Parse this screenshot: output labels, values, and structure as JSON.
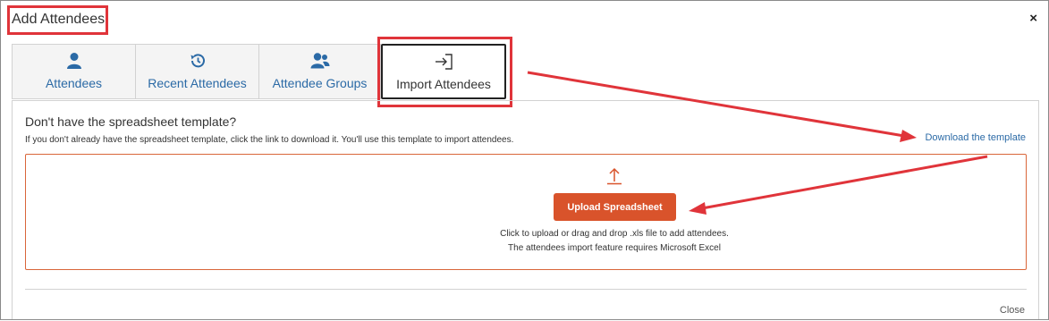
{
  "dialog": {
    "title": "Add Attendees",
    "close_glyph": "×"
  },
  "tabs": [
    {
      "label": "Attendees",
      "icon": "person-icon",
      "active": false
    },
    {
      "label": "Recent Attendees",
      "icon": "history-icon",
      "active": false
    },
    {
      "label": "Attendee Groups",
      "icon": "group-icon",
      "active": false
    },
    {
      "label": "Import Attendees",
      "icon": "import-icon",
      "active": true
    }
  ],
  "import": {
    "question": "Don't have the spreadsheet template?",
    "instructions": "If you don't already have the spreadsheet template, click the link to download it. You'll use this template to import attendees.",
    "download_link": "Download the template",
    "upload_button": "Upload Spreadsheet",
    "hint_line1": "Click to upload or drag and drop .xls file to add attendees.",
    "hint_line2": "The attendees import feature requires Microsoft Excel"
  },
  "footer": {
    "close_label": "Close"
  },
  "colors": {
    "annotation_red": "#e0343a",
    "upload_orange": "#d9532b",
    "link_blue": "#2b6aa6"
  }
}
